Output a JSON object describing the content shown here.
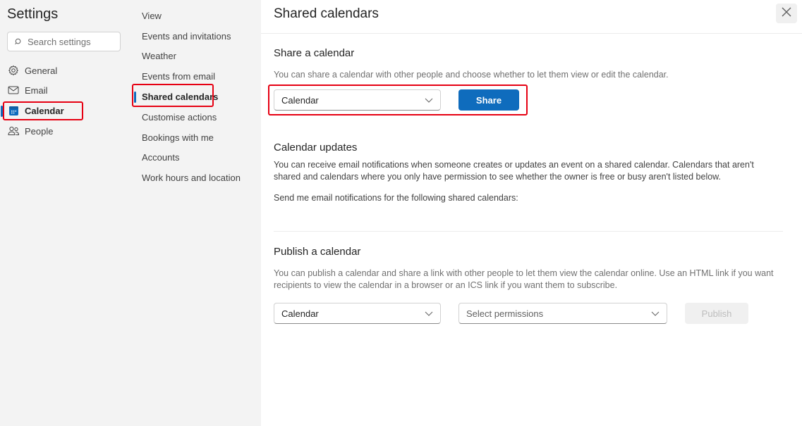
{
  "settings": {
    "title": "Settings",
    "search_placeholder": "Search settings",
    "nav": [
      {
        "label": "General",
        "icon": "gear-icon"
      },
      {
        "label": "Email",
        "icon": "mail-icon"
      },
      {
        "label": "Calendar",
        "icon": "calendar-icon",
        "active": true
      },
      {
        "label": "People",
        "icon": "people-icon"
      }
    ]
  },
  "calendar_menu": {
    "items": [
      {
        "label": "View"
      },
      {
        "label": "Events and invitations"
      },
      {
        "label": "Weather"
      },
      {
        "label": "Events from email"
      },
      {
        "label": "Shared calendars",
        "active": true
      },
      {
        "label": "Customise actions"
      },
      {
        "label": "Bookings with me"
      },
      {
        "label": "Accounts"
      },
      {
        "label": "Work hours and location"
      }
    ]
  },
  "main": {
    "title": "Shared calendars",
    "close_label": "Close",
    "share": {
      "heading": "Share a calendar",
      "description": "You can share a calendar with other people and choose whether to let them view or edit the calendar.",
      "calendar_selected": "Calendar",
      "share_button": "Share"
    },
    "updates": {
      "heading": "Calendar updates",
      "description": "You can receive email notifications when someone creates or updates an event on a shared calendar. Calendars that aren't shared and calendars where you only have permission to see whether the owner is free or busy aren't listed below.",
      "notify_label": "Send me email notifications for the following shared calendars:"
    },
    "publish": {
      "heading": "Publish a calendar",
      "description": "You can publish a calendar and share a link with other people to let them view the calendar online. Use an HTML link if you want recipients to view the calendar in a browser or an ICS link if you want them to subscribe.",
      "calendar_selected": "Calendar",
      "permissions_placeholder": "Select permissions",
      "publish_button": "Publish"
    }
  },
  "colors": {
    "accent": "#0f6cbd",
    "highlight": "#e60012"
  }
}
